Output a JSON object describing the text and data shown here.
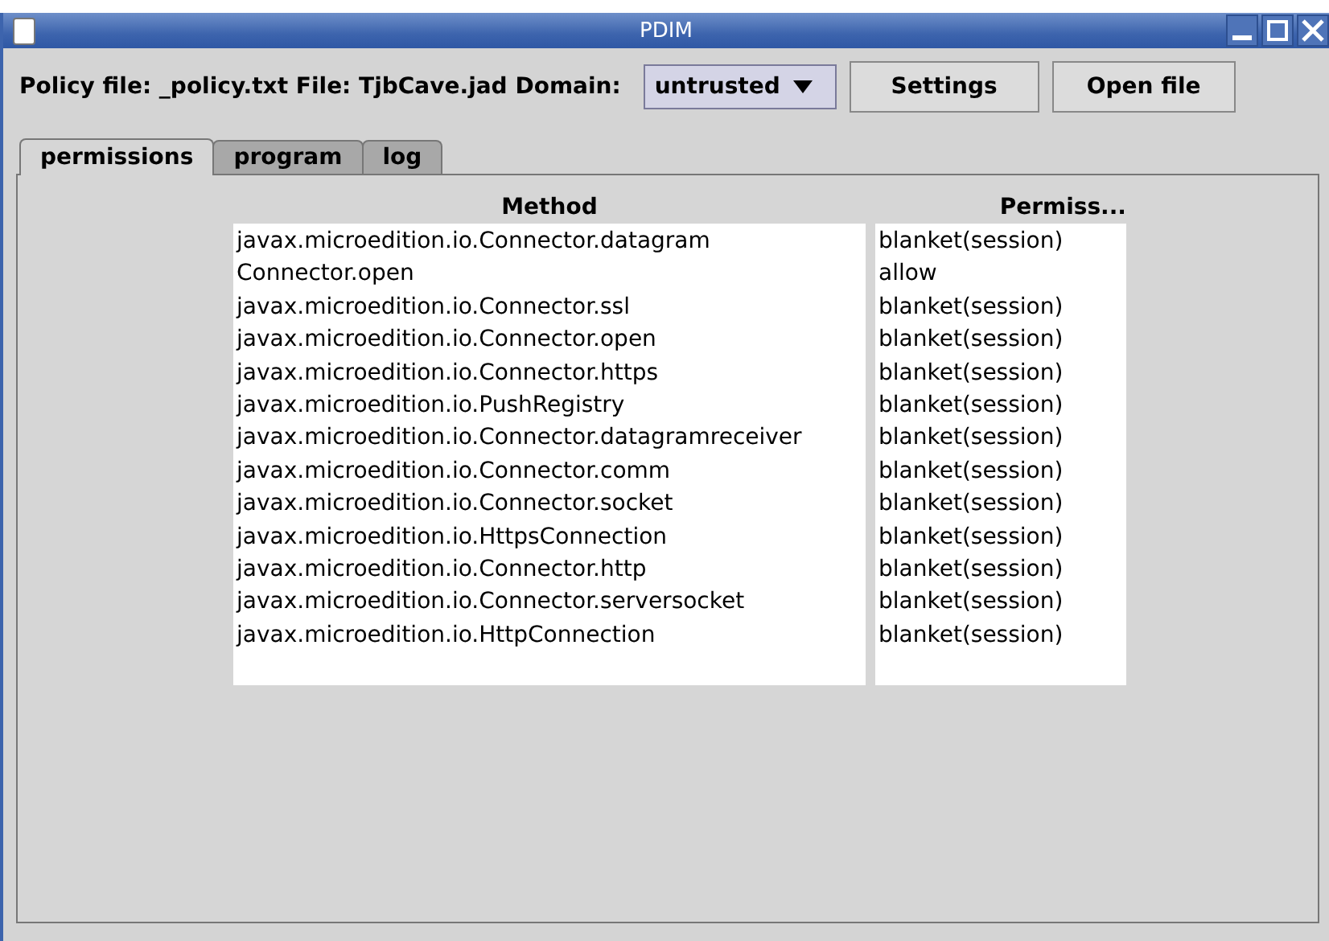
{
  "window": {
    "title": "PDIM"
  },
  "toolbar": {
    "info": "Policy file: _policy.txt File: TjbCave.jad Domain:",
    "domain": {
      "value": "untrusted"
    },
    "buttons": [
      "Settings",
      "Open file"
    ]
  },
  "tabs": [
    {
      "label": "permissions",
      "selected": true
    },
    {
      "label": "program",
      "selected": false
    },
    {
      "label": "log",
      "selected": false
    }
  ],
  "table": {
    "columns": [
      "Method",
      "Permiss..."
    ],
    "rows": [
      [
        "javax.microedition.io.Connector.datagram",
        "blanket(session)"
      ],
      [
        "Connector.open",
        "allow"
      ],
      [
        "javax.microedition.io.Connector.ssl",
        "blanket(session)"
      ],
      [
        "javax.microedition.io.Connector.open",
        "blanket(session)"
      ],
      [
        "javax.microedition.io.Connector.https",
        "blanket(session)"
      ],
      [
        "javax.microedition.io.PushRegistry",
        "blanket(session)"
      ],
      [
        "javax.microedition.io.Connector.datagramreceiver",
        "blanket(session)"
      ],
      [
        "javax.microedition.io.Connector.comm",
        "blanket(session)"
      ],
      [
        "javax.microedition.io.Connector.socket",
        "blanket(session)"
      ],
      [
        "javax.microedition.io.HttpsConnection",
        "blanket(session)"
      ],
      [
        "javax.microedition.io.Connector.http",
        "blanket(session)"
      ],
      [
        "javax.microedition.io.Connector.serversocket",
        "blanket(session)"
      ],
      [
        "javax.microedition.io.HttpConnection",
        "blanket(session)"
      ]
    ]
  }
}
